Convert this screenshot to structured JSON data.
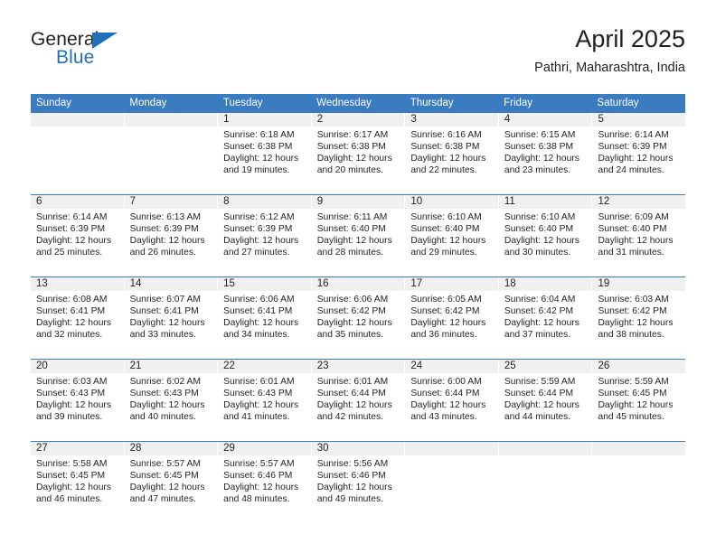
{
  "branding": {
    "logo_text_primary": "General",
    "logo_text_secondary": "Blue",
    "logo_triangle_icon": "triangle-icon",
    "primary_color": "#1d71b8",
    "header_band_color": "#3a7cbf",
    "daynum_band_color": "#f0f0f0"
  },
  "header": {
    "title": "April 2025",
    "subtitle": "Pathri, Maharashtra, India"
  },
  "calendar": {
    "weekdays": [
      "Sunday",
      "Monday",
      "Tuesday",
      "Wednesday",
      "Thursday",
      "Friday",
      "Saturday"
    ],
    "weeks": [
      [
        {
          "day": "",
          "lines": []
        },
        {
          "day": "",
          "lines": []
        },
        {
          "day": "1",
          "lines": [
            "Sunrise: 6:18 AM",
            "Sunset: 6:38 PM",
            "Daylight: 12 hours",
            "and 19 minutes."
          ]
        },
        {
          "day": "2",
          "lines": [
            "Sunrise: 6:17 AM",
            "Sunset: 6:38 PM",
            "Daylight: 12 hours",
            "and 20 minutes."
          ]
        },
        {
          "day": "3",
          "lines": [
            "Sunrise: 6:16 AM",
            "Sunset: 6:38 PM",
            "Daylight: 12 hours",
            "and 22 minutes."
          ]
        },
        {
          "day": "4",
          "lines": [
            "Sunrise: 6:15 AM",
            "Sunset: 6:38 PM",
            "Daylight: 12 hours",
            "and 23 minutes."
          ]
        },
        {
          "day": "5",
          "lines": [
            "Sunrise: 6:14 AM",
            "Sunset: 6:39 PM",
            "Daylight: 12 hours",
            "and 24 minutes."
          ]
        }
      ],
      [
        {
          "day": "6",
          "lines": [
            "Sunrise: 6:14 AM",
            "Sunset: 6:39 PM",
            "Daylight: 12 hours",
            "and 25 minutes."
          ]
        },
        {
          "day": "7",
          "lines": [
            "Sunrise: 6:13 AM",
            "Sunset: 6:39 PM",
            "Daylight: 12 hours",
            "and 26 minutes."
          ]
        },
        {
          "day": "8",
          "lines": [
            "Sunrise: 6:12 AM",
            "Sunset: 6:39 PM",
            "Daylight: 12 hours",
            "and 27 minutes."
          ]
        },
        {
          "day": "9",
          "lines": [
            "Sunrise: 6:11 AM",
            "Sunset: 6:40 PM",
            "Daylight: 12 hours",
            "and 28 minutes."
          ]
        },
        {
          "day": "10",
          "lines": [
            "Sunrise: 6:10 AM",
            "Sunset: 6:40 PM",
            "Daylight: 12 hours",
            "and 29 minutes."
          ]
        },
        {
          "day": "11",
          "lines": [
            "Sunrise: 6:10 AM",
            "Sunset: 6:40 PM",
            "Daylight: 12 hours",
            "and 30 minutes."
          ]
        },
        {
          "day": "12",
          "lines": [
            "Sunrise: 6:09 AM",
            "Sunset: 6:40 PM",
            "Daylight: 12 hours",
            "and 31 minutes."
          ]
        }
      ],
      [
        {
          "day": "13",
          "lines": [
            "Sunrise: 6:08 AM",
            "Sunset: 6:41 PM",
            "Daylight: 12 hours",
            "and 32 minutes."
          ]
        },
        {
          "day": "14",
          "lines": [
            "Sunrise: 6:07 AM",
            "Sunset: 6:41 PM",
            "Daylight: 12 hours",
            "and 33 minutes."
          ]
        },
        {
          "day": "15",
          "lines": [
            "Sunrise: 6:06 AM",
            "Sunset: 6:41 PM",
            "Daylight: 12 hours",
            "and 34 minutes."
          ]
        },
        {
          "day": "16",
          "lines": [
            "Sunrise: 6:06 AM",
            "Sunset: 6:42 PM",
            "Daylight: 12 hours",
            "and 35 minutes."
          ]
        },
        {
          "day": "17",
          "lines": [
            "Sunrise: 6:05 AM",
            "Sunset: 6:42 PM",
            "Daylight: 12 hours",
            "and 36 minutes."
          ]
        },
        {
          "day": "18",
          "lines": [
            "Sunrise: 6:04 AM",
            "Sunset: 6:42 PM",
            "Daylight: 12 hours",
            "and 37 minutes."
          ]
        },
        {
          "day": "19",
          "lines": [
            "Sunrise: 6:03 AM",
            "Sunset: 6:42 PM",
            "Daylight: 12 hours",
            "and 38 minutes."
          ]
        }
      ],
      [
        {
          "day": "20",
          "lines": [
            "Sunrise: 6:03 AM",
            "Sunset: 6:43 PM",
            "Daylight: 12 hours",
            "and 39 minutes."
          ]
        },
        {
          "day": "21",
          "lines": [
            "Sunrise: 6:02 AM",
            "Sunset: 6:43 PM",
            "Daylight: 12 hours",
            "and 40 minutes."
          ]
        },
        {
          "day": "22",
          "lines": [
            "Sunrise: 6:01 AM",
            "Sunset: 6:43 PM",
            "Daylight: 12 hours",
            "and 41 minutes."
          ]
        },
        {
          "day": "23",
          "lines": [
            "Sunrise: 6:01 AM",
            "Sunset: 6:44 PM",
            "Daylight: 12 hours",
            "and 42 minutes."
          ]
        },
        {
          "day": "24",
          "lines": [
            "Sunrise: 6:00 AM",
            "Sunset: 6:44 PM",
            "Daylight: 12 hours",
            "and 43 minutes."
          ]
        },
        {
          "day": "25",
          "lines": [
            "Sunrise: 5:59 AM",
            "Sunset: 6:44 PM",
            "Daylight: 12 hours",
            "and 44 minutes."
          ]
        },
        {
          "day": "26",
          "lines": [
            "Sunrise: 5:59 AM",
            "Sunset: 6:45 PM",
            "Daylight: 12 hours",
            "and 45 minutes."
          ]
        }
      ],
      [
        {
          "day": "27",
          "lines": [
            "Sunrise: 5:58 AM",
            "Sunset: 6:45 PM",
            "Daylight: 12 hours",
            "and 46 minutes."
          ]
        },
        {
          "day": "28",
          "lines": [
            "Sunrise: 5:57 AM",
            "Sunset: 6:45 PM",
            "Daylight: 12 hours",
            "and 47 minutes."
          ]
        },
        {
          "day": "29",
          "lines": [
            "Sunrise: 5:57 AM",
            "Sunset: 6:46 PM",
            "Daylight: 12 hours",
            "and 48 minutes."
          ]
        },
        {
          "day": "30",
          "lines": [
            "Sunrise: 5:56 AM",
            "Sunset: 6:46 PM",
            "Daylight: 12 hours",
            "and 49 minutes."
          ]
        },
        {
          "day": "",
          "lines": []
        },
        {
          "day": "",
          "lines": []
        },
        {
          "day": "",
          "lines": []
        }
      ]
    ]
  }
}
